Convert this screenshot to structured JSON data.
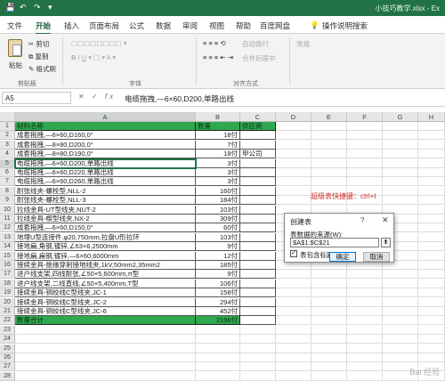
{
  "titlebar": {
    "filename": "小技巧教学.xlsx - Ex",
    "save_icon": "save-icon",
    "undo_icon": "undo-icon",
    "redo_icon": "redo-icon"
  },
  "tabs": [
    "文件",
    "开始",
    "插入",
    "页面布局",
    "公式",
    "数据",
    "审阅",
    "视图",
    "帮助",
    "百度网盘"
  ],
  "active_tab": "开始",
  "search_tell_me": "操作说明搜索",
  "ribbon": {
    "cut": "剪切",
    "copy": "复制",
    "format_painter": "格式刷",
    "paste": "粘贴",
    "clipboard_group": "剪贴板",
    "font_group": "字体",
    "align_group": "对齐方式",
    "wrap": "自动换行",
    "merge": "合并后居中",
    "number_format": "常规"
  },
  "formula_bar": {
    "name_box": "A5",
    "fx": "fx",
    "content": "电缆拖拽,—6×60,D200,单路出线"
  },
  "columns": [
    "A",
    "B",
    "C",
    "D",
    "E",
    "F",
    "G",
    "H"
  ],
  "rows": [
    {
      "n": "1",
      "a": "材料名称",
      "b": "数量",
      "c": "供应商"
    },
    {
      "n": "2",
      "a": "成套拖拽,—6×60,D160,0°",
      "b": "18付",
      "c": ""
    },
    {
      "n": "3",
      "a": "成套拖拽,—8×80,D200,0°",
      "b": "7付",
      "c": ""
    },
    {
      "n": "4",
      "a": "成套拖拽,—8×80,D190,0°",
      "b": "18付",
      "c": "甲公司"
    },
    {
      "n": "5",
      "a": "电缆拖拽,—6×60,D200,单路出线",
      "b": "3付",
      "c": ""
    },
    {
      "n": "6",
      "a": "电缆拖拽,—6×60,D220,单路出线",
      "b": "3付",
      "c": ""
    },
    {
      "n": "7",
      "a": "电缆拖拽,—6×60,D260,单路出线",
      "b": "3付",
      "c": ""
    },
    {
      "n": "8",
      "a": "耐张线夹-螺栓型,NLL-2",
      "b": "160付",
      "c": ""
    },
    {
      "n": "9",
      "a": "耐张线夹-螺栓型,NLL-3",
      "b": "184付",
      "c": ""
    },
    {
      "n": "10",
      "a": "拉线金具-UT型线夹,NUT-2",
      "b": "103付",
      "c": ""
    },
    {
      "n": "11",
      "a": "拉线金具-楔型线夹,NX-2",
      "b": "309付",
      "c": ""
    },
    {
      "n": "12",
      "a": "成套拖拽,—6×60,D150,0°",
      "b": "60付",
      "c": ""
    },
    {
      "n": "13",
      "a": "地埋U型连接件,φ20,750mm,拉盘U形拉环",
      "b": "103付",
      "c": ""
    },
    {
      "n": "14",
      "a": "接地扁,角钢,镀锌,∠63×6,2500mm",
      "b": "9付",
      "c": ""
    },
    {
      "n": "15",
      "a": "接地扁,扁钢,镀锌,—6×60,6000mm",
      "b": "12付",
      "c": ""
    },
    {
      "n": "16",
      "a": "接续金具-绝缘穿刺接地线夹,1kV,50mm2,35mm2",
      "b": "185付",
      "c": ""
    },
    {
      "n": "17",
      "a": "进户线支架,四线耐张,∠50×5,600mm,π型",
      "b": "9付",
      "c": ""
    },
    {
      "n": "18",
      "a": "进户线支架,二线直线,∠50×5,400mm,T型",
      "b": "106付",
      "c": ""
    },
    {
      "n": "19",
      "a": "接续金具-铜绞线C型线夹,JC-1",
      "b": "158付",
      "c": ""
    },
    {
      "n": "20",
      "a": "接续金具-铜绞线C型线夹,JC-2",
      "b": "294付",
      "c": ""
    },
    {
      "n": "21",
      "a": "接续金具-铜绞线C型线夹,JC-6",
      "b": "452付",
      "c": ""
    },
    {
      "n": "22",
      "a": "数量合计",
      "b": "2196付",
      "c": ""
    },
    {
      "n": "23",
      "a": "",
      "b": "",
      "c": ""
    },
    {
      "n": "24",
      "a": "",
      "b": "",
      "c": ""
    },
    {
      "n": "25",
      "a": "",
      "b": "",
      "c": ""
    },
    {
      "n": "26",
      "a": "",
      "b": "",
      "c": ""
    },
    {
      "n": "27",
      "a": "",
      "b": "",
      "c": ""
    },
    {
      "n": "28",
      "a": "",
      "b": "",
      "c": ""
    }
  ],
  "hint_text": "超级表快捷键：ctrl+t",
  "dialog": {
    "title": "创建表",
    "help": "?",
    "close": "✕",
    "source_label": "表数据的来源(W):",
    "range_value": "$A$1:$C$21",
    "has_headers_label": "表包含标题(M)",
    "has_headers_checked": true,
    "ok": "确定",
    "cancel": "取消"
  },
  "watermark": "Bai 经验",
  "colors": {
    "excel_green": "#217346",
    "header_fill": "#2fa84f",
    "hint_red": "#d0312d"
  }
}
